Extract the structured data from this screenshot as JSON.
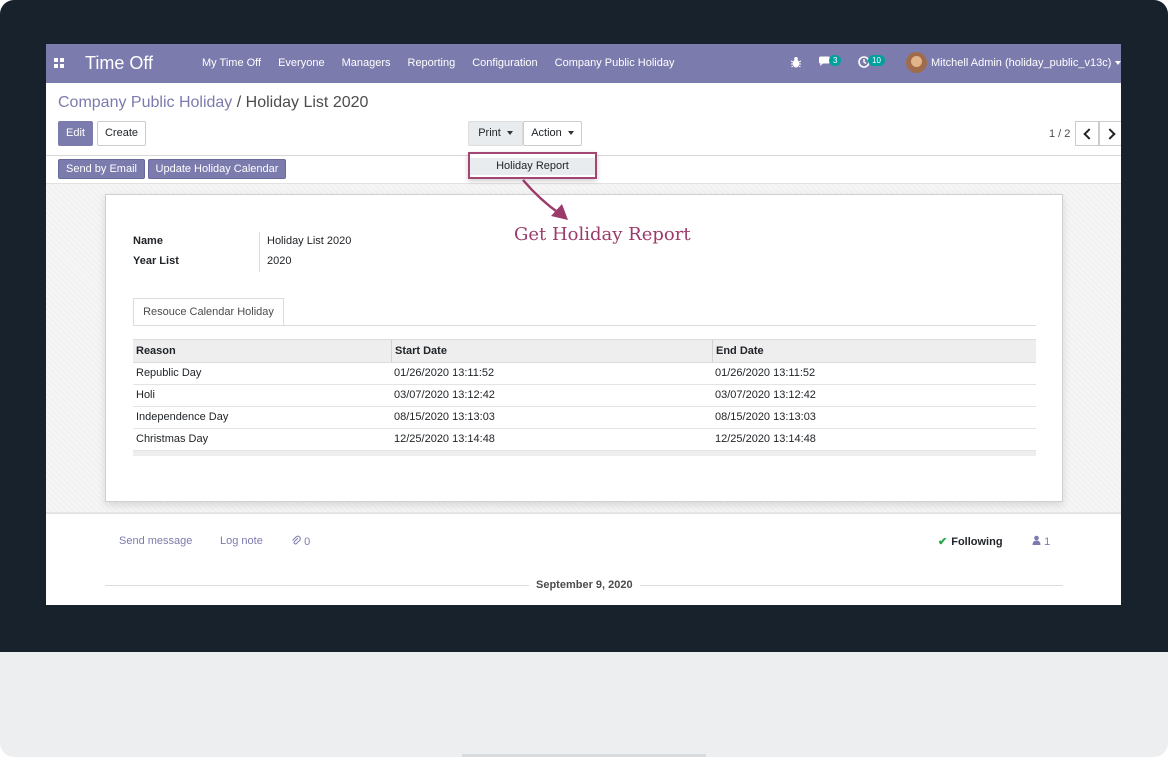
{
  "navbar": {
    "app_title": "Time Off",
    "menu": [
      "My Time Off",
      "Everyone",
      "Managers",
      "Reporting",
      "Configuration",
      "Company Public Holiday"
    ],
    "messages_count": "3",
    "activities_count": "10",
    "user_name": "Mitchell Admin (holiday_public_v13c)"
  },
  "breadcrumb": {
    "parent": "Company Public Holiday",
    "separator": "/",
    "current": "Holiday List 2020"
  },
  "buttons": {
    "edit": "Edit",
    "create": "Create",
    "print": "Print",
    "action": "Action",
    "send_email": "Send by Email",
    "update_calendar": "Update Holiday Calendar"
  },
  "pager": {
    "value": "1 / 2"
  },
  "print_menu": {
    "items": [
      "Holiday Report"
    ]
  },
  "annotation": {
    "text": "Get Holiday Report"
  },
  "form": {
    "fields": [
      {
        "label": "Name",
        "value": "Holiday List 2020"
      },
      {
        "label": "Year List",
        "value": "2020"
      }
    ],
    "tab_label": "Resouce Calendar Holiday"
  },
  "table": {
    "headers": [
      "Reason",
      "Start Date",
      "End Date"
    ],
    "rows": [
      [
        "Republic Day",
        "01/26/2020 13:11:52",
        "01/26/2020 13:11:52"
      ],
      [
        "Holi",
        "03/07/2020 13:12:42",
        "03/07/2020 13:12:42"
      ],
      [
        "Independence Day",
        "08/15/2020 13:13:03",
        "08/15/2020 13:13:03"
      ],
      [
        "Christmas Day",
        "12/25/2020 13:14:48",
        "12/25/2020 13:14:48"
      ]
    ]
  },
  "chatter": {
    "send_message": "Send message",
    "log_note": "Log note",
    "attachments_count": "0",
    "following": "Following",
    "followers_count": "1",
    "date_separator": "September 9, 2020"
  },
  "colors": {
    "brand": "#7c7bad",
    "highlight": "#a24773",
    "annotation": "#9c3b6b"
  }
}
